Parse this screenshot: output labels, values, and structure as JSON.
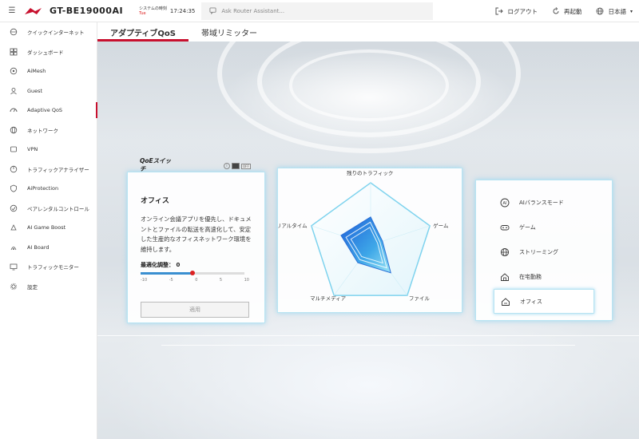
{
  "header": {
    "menu_icon": "hamburger-icon",
    "model": "GT-BE19000AI",
    "system_time_label": "システムの時刻",
    "system_day": "Tue",
    "clock": "17:24:35",
    "assistant_placeholder": "Ask Router Assistant...",
    "logout": "ログアウト",
    "reboot": "再起動",
    "language": "日本語"
  },
  "sidebar": {
    "items": [
      {
        "label": "クイックインターネット",
        "icon": "globe-gear-icon"
      },
      {
        "label": "ダッシュボード",
        "icon": "dashboard-icon"
      },
      {
        "label": "AiMesh",
        "icon": "mesh-icon"
      },
      {
        "label": "Guest",
        "icon": "guest-icon"
      },
      {
        "label": "Adaptive QoS",
        "icon": "qos-icon"
      },
      {
        "label": "ネットワーク",
        "icon": "network-icon"
      },
      {
        "label": "VPN",
        "icon": "vpn-icon"
      },
      {
        "label": "トラフィックアナライザー",
        "icon": "analyzer-icon"
      },
      {
        "label": "AiProtection",
        "icon": "shield-icon"
      },
      {
        "label": "ペアレンタルコントロール",
        "icon": "parental-icon"
      },
      {
        "label": "AI Game Boost",
        "icon": "game-boost-icon"
      },
      {
        "label": "AI Board",
        "icon": "ai-board-icon"
      },
      {
        "label": "トラフィックモニター",
        "icon": "monitor-icon"
      },
      {
        "label": "設定",
        "icon": "gear-icon"
      }
    ],
    "active_index": 4
  },
  "tabs": [
    {
      "label": "アダプティブQoS",
      "active": true
    },
    {
      "label": "帯域リミッター",
      "active": false
    }
  ],
  "qos": {
    "switch_label": "QoEスイッチ",
    "switch_state": "OFF",
    "title": "オフィス",
    "description": "オンライン会議アプリを優先し、ドキュメントとファイルの転送を高速化して、安定した生産的なオフィスネットワーク環境を維持します。",
    "optimize_label": "最適化調整：",
    "optimize_value": "0",
    "slider_min": -10,
    "slider_max": 10,
    "slider_value": 0,
    "ticks": [
      "-10",
      "-5",
      "0",
      "5",
      "10"
    ],
    "apply": "適用"
  },
  "radar": {
    "axes": [
      "残りのトラフィック",
      "ゲーム",
      "ファイル",
      "マルチメディア",
      "リアルタイム"
    ],
    "values": [
      0.45,
      0.2,
      0.55,
      0.35,
      0.5
    ]
  },
  "modes": {
    "items": [
      {
        "label": "AIバランスモード",
        "icon": "ai-icon"
      },
      {
        "label": "ゲーム",
        "icon": "gamepad-icon"
      },
      {
        "label": "ストリーミング",
        "icon": "globe-icon"
      },
      {
        "label": "在宅勤務",
        "icon": "home-work-icon"
      },
      {
        "label": "オフィス",
        "icon": "office-icon"
      }
    ],
    "active_index": 4
  }
}
